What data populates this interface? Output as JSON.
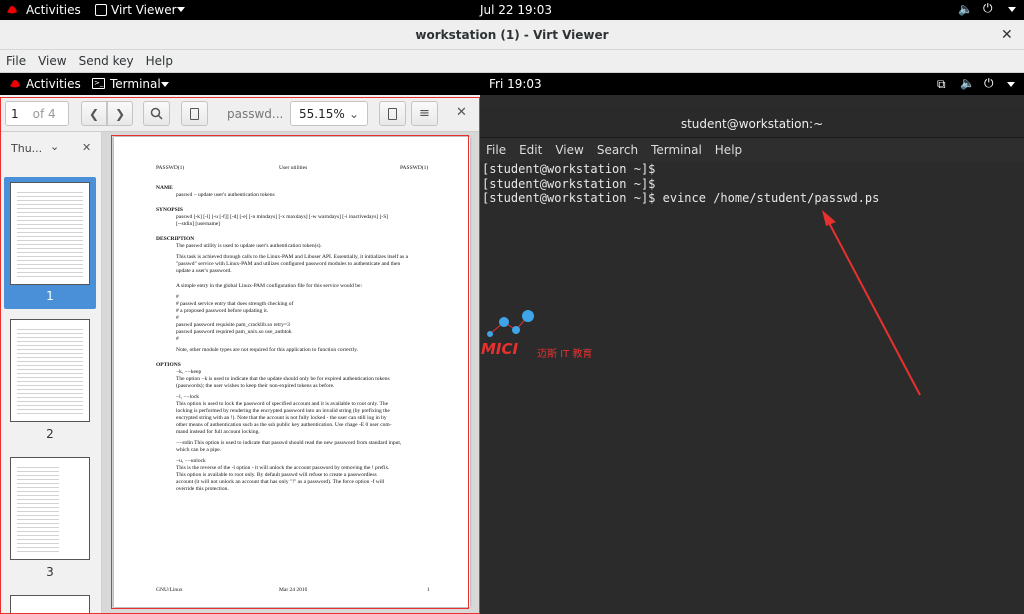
{
  "host_topbar": {
    "activities": "Activities",
    "app_menu": "Virt Viewer",
    "clock": "Jul 22  19:03"
  },
  "vv_window": {
    "title": "workstation (1) - Virt Viewer",
    "menu": [
      "File",
      "View",
      "Send key",
      "Help"
    ]
  },
  "guest_topbar": {
    "activities": "Activities",
    "app_menu": "Terminal",
    "clock": "Fri 19:03"
  },
  "evince": {
    "page_number": "1",
    "page_total": "of 4",
    "doc_title": "passwd...",
    "zoom": "55.15%",
    "sidebar_mode": "Thu...",
    "thumbnails": [
      "1",
      "2",
      "3"
    ],
    "selected_thumbnail": "1",
    "page": {
      "header_left": "PASSWD(1)",
      "header_center": "User utilities",
      "header_right": "PASSWD(1)",
      "footer_left": "GNU/Linux",
      "footer_center": "Mar 24 2010",
      "footer_right": "1",
      "sections": [
        {
          "heading": "NAME",
          "lines": [
            "passwd − update user's authentication tokens"
          ]
        },
        {
          "heading": "SYNOPSIS",
          "lines": [
            "passwd [-k] [-l] [-u [-f]] [-d] [-e] [-n mindays] [-x maxdays] [-w warndays] [-i inactivedays] [-S]",
            "[--stdin] [username]"
          ]
        },
        {
          "heading": "DESCRIPTION",
          "lines": [
            "The passwd utility is used to update user's authentication token(s).",
            "",
            "This task is achieved through calls to the Linux-PAM and Libuser API. Essentially, it initializes itself as a",
            "\"passwd\" service with Linux-PAM and utilizes configured password modules to authenticate and then",
            "update a user's password.",
            "",
            "",
            "A simple entry in the global Linux-PAM configuration file for this service would be:",
            "",
            "#",
            "# passwd service entry that does strength checking of",
            "# a proposed password before updating it.",
            "#",
            "passwd password requisite pam_cracklib.so retry=3",
            "passwd password required pam_unix.so use_authtok",
            "#",
            "",
            "Note, other module types are not required for this application to function correctly."
          ]
        },
        {
          "heading": "OPTIONS",
          "lines": [
            "−k, −−keep",
            "      The option −k is used to indicate that the update should only be for expired authentication tokens",
            "      (passwords); the user wishes to keep their non-expired tokens as before.",
            "",
            "−l, −−lock",
            "      This option is used to lock the password of specified account and it is available to root only. The",
            "      locking is performed by rendering the encrypted password into an invalid string (by prefixing the",
            "      encrypted string with an !). Note that the account is not fully locked - the user can still log in by",
            "      other means of authentication such as the ssh public key authentication. Use chage -E 0 user com-",
            "      mand instead for full account locking.",
            "",
            "−−stdin  This option is used to indicate that passwd should read the new password from standard input,",
            "      which can be a pipe.",
            "",
            "−u, −−unlock",
            "      This is the reverse of the -l option - it will unlock the account password by removing the ! prefix.",
            "      This option is available to root only. By default passwd will refuse to create a passwordless",
            "      account (it will not unlock an account that has only \"!\" as a password). The force option -f will",
            "      override this protection."
          ]
        }
      ]
    }
  },
  "terminal": {
    "title": "student@workstation:~",
    "menu": [
      "File",
      "Edit",
      "View",
      "Search",
      "Terminal",
      "Help"
    ],
    "lines": [
      "[student@workstation ~]$",
      "[student@workstation ~]$",
      "[student@workstation ~]$ evince /home/student/passwd.ps"
    ]
  },
  "watermark": {
    "brand": "MICI",
    "subtitle": "迈斯 IT 教育"
  },
  "colors": {
    "annotation": "#e8312f",
    "selection": "#4a90d9",
    "watermark": "#e8312f"
  }
}
